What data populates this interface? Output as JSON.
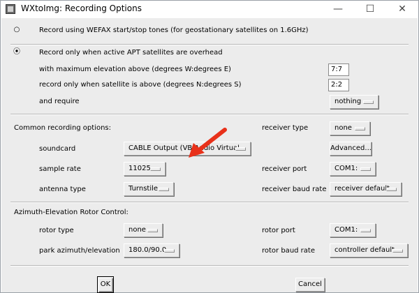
{
  "window": {
    "title": "WXtoImg: Recording Options",
    "controls": {
      "minimize": "—",
      "maximize": "☐",
      "close": "✕"
    }
  },
  "wefax": {
    "label": "Record using WEFAX start/stop tones (for geostationary satellites on 1.6GHz)",
    "selected": false
  },
  "apt": {
    "label": "Record only when active APT satellites are overhead",
    "selected": true,
    "max_elevation_label": "with maximum elevation above (degrees W:degrees E)",
    "max_elevation_value": "7:7",
    "satellite_above_label": "record only when satellite is above (degrees N:degrees S)",
    "satellite_above_value": "2:2",
    "require_label": "and require",
    "require_value": "nothing"
  },
  "common": {
    "heading": "Common recording options:",
    "soundcard_label": "soundcard",
    "soundcard_value": "CABLE Output (VB-Audio Virtual",
    "sample_rate_label": "sample rate",
    "sample_rate_value": "11025",
    "antenna_type_label": "antenna type",
    "antenna_type_value": "Turnstile",
    "receiver_type_label": "receiver type",
    "receiver_type_value": "none",
    "advanced_label": "Advanced...",
    "receiver_port_label": "receiver port",
    "receiver_port_value": "COM1:",
    "receiver_baud_label": "receiver baud rate",
    "receiver_baud_value": "receiver default"
  },
  "rotor": {
    "heading": "Azimuth-Elevation Rotor Control:",
    "rotor_type_label": "rotor type",
    "rotor_type_value": "none",
    "park_label": "park azimuth/elevation",
    "park_value": "180.0/90.0",
    "rotor_port_label": "rotor port",
    "rotor_port_value": "COM1:",
    "rotor_baud_label": "rotor baud rate",
    "rotor_baud_value": "controller default"
  },
  "buttons": {
    "ok": "OK",
    "cancel": "Cancel"
  },
  "colors": {
    "annotation_arrow": "#e8311a",
    "dialog_bg": "#ececec"
  },
  "icons": {
    "app": "app-icon",
    "radio_on": "radio-selected-icon",
    "radio_off": "radio-unselected-icon",
    "annotation": "red-arrow-annotation"
  }
}
